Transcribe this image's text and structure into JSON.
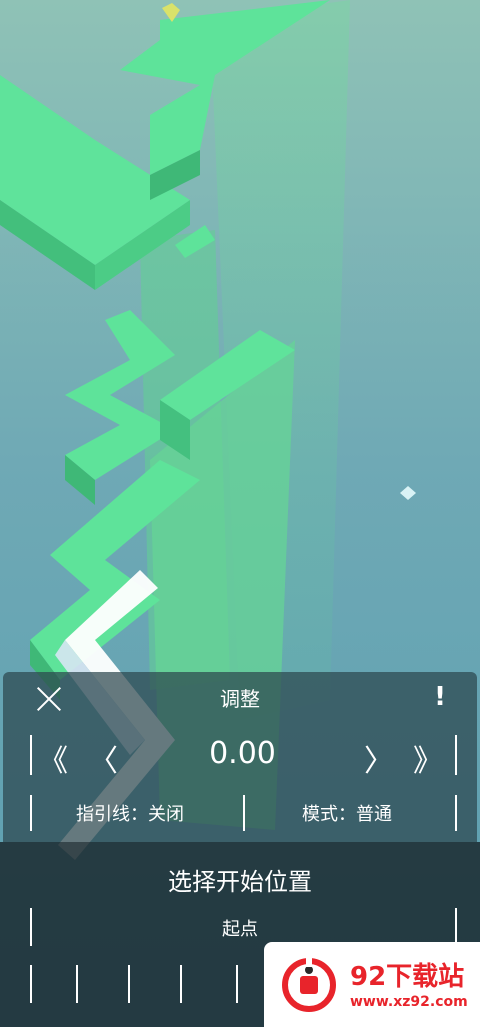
{
  "adjust_panel": {
    "title": "调整",
    "close_icon": "close-icon",
    "warn_label": "!",
    "step_back_fast": "《",
    "step_back": "〈",
    "offset_value": "0.00",
    "step_forward": "〉",
    "step_forward_fast": "》",
    "guideline_label": "指引线：关闭",
    "mode_label": "模式：普通"
  },
  "start_panel": {
    "title": "选择开始位置",
    "start_point_label": "起点"
  },
  "watermark": {
    "title": "92下载站",
    "url": "www.xz92.com"
  },
  "colors": {
    "path_green": "#5ee39a",
    "path_shadow": "#3fb877",
    "background": "#6fa9b5",
    "white_trail": "#ffffff",
    "watermark_red": "#e8242b"
  }
}
